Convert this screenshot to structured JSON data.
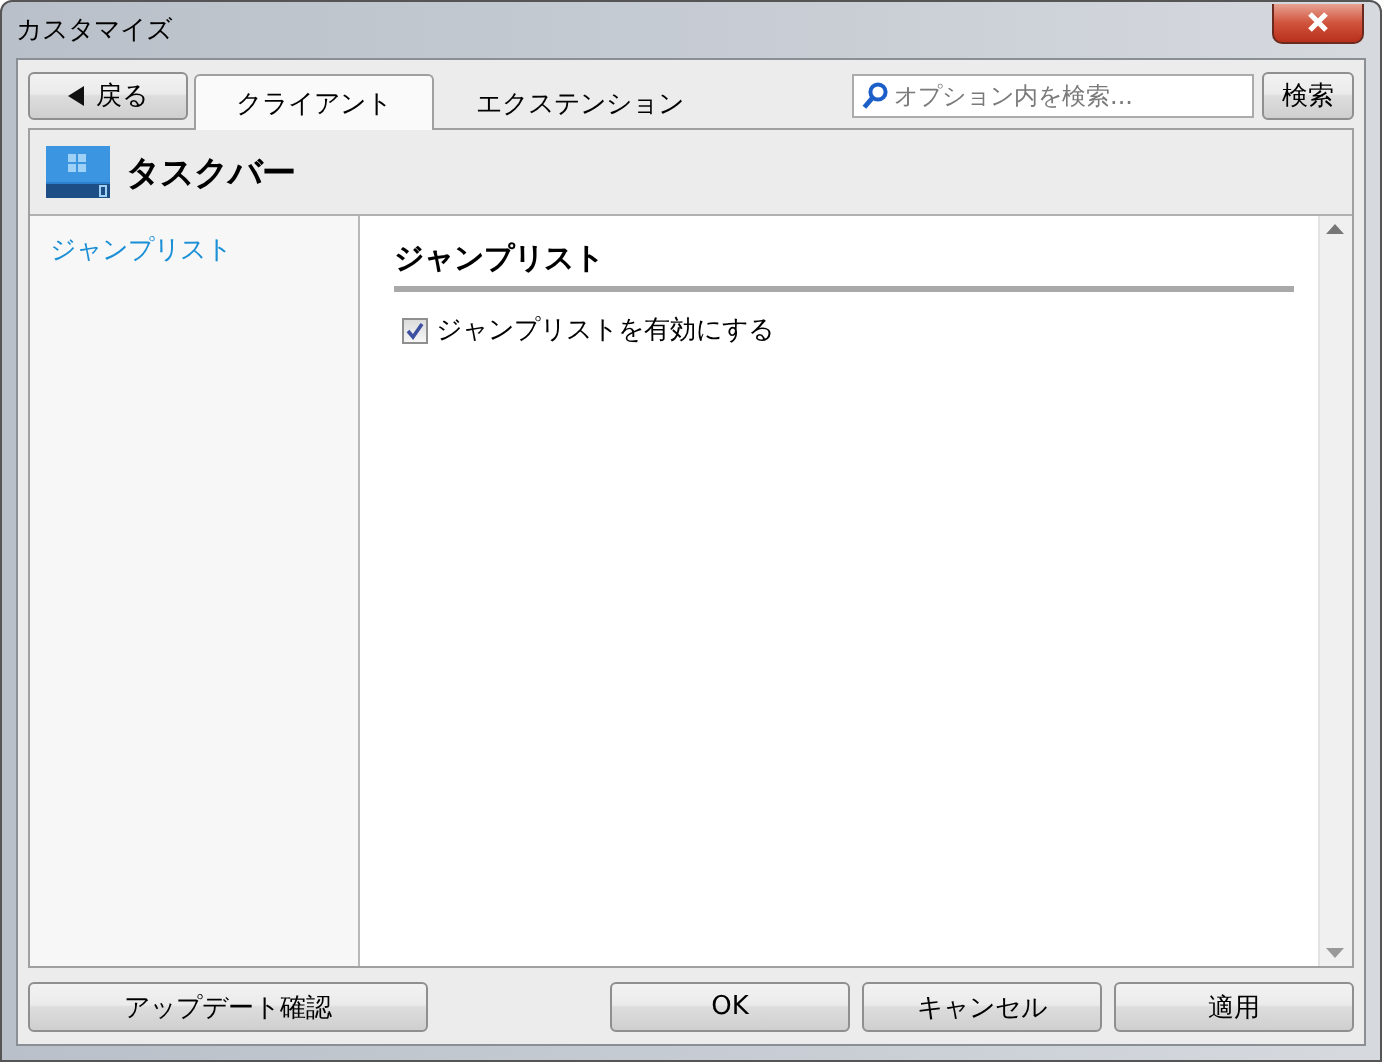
{
  "window": {
    "title": "カスタマイズ"
  },
  "back_button": {
    "label": "戻る"
  },
  "tabs": [
    {
      "label": "クライアント",
      "selected": true
    },
    {
      "label": "エクステンション",
      "selected": false
    }
  ],
  "search": {
    "placeholder": "オプション内を検索...",
    "button": "検索"
  },
  "section": {
    "title": "タスクバー"
  },
  "sidebar": {
    "items": [
      {
        "label": "ジャンプリスト",
        "selected": true
      }
    ]
  },
  "panel": {
    "heading": "ジャンプリスト",
    "options": [
      {
        "label": "ジャンプリストを有効にする",
        "checked": true
      }
    ]
  },
  "footer": {
    "update_button": "アップデート確認",
    "buttons": [
      "OK",
      "キャンセル",
      "適用"
    ]
  }
}
